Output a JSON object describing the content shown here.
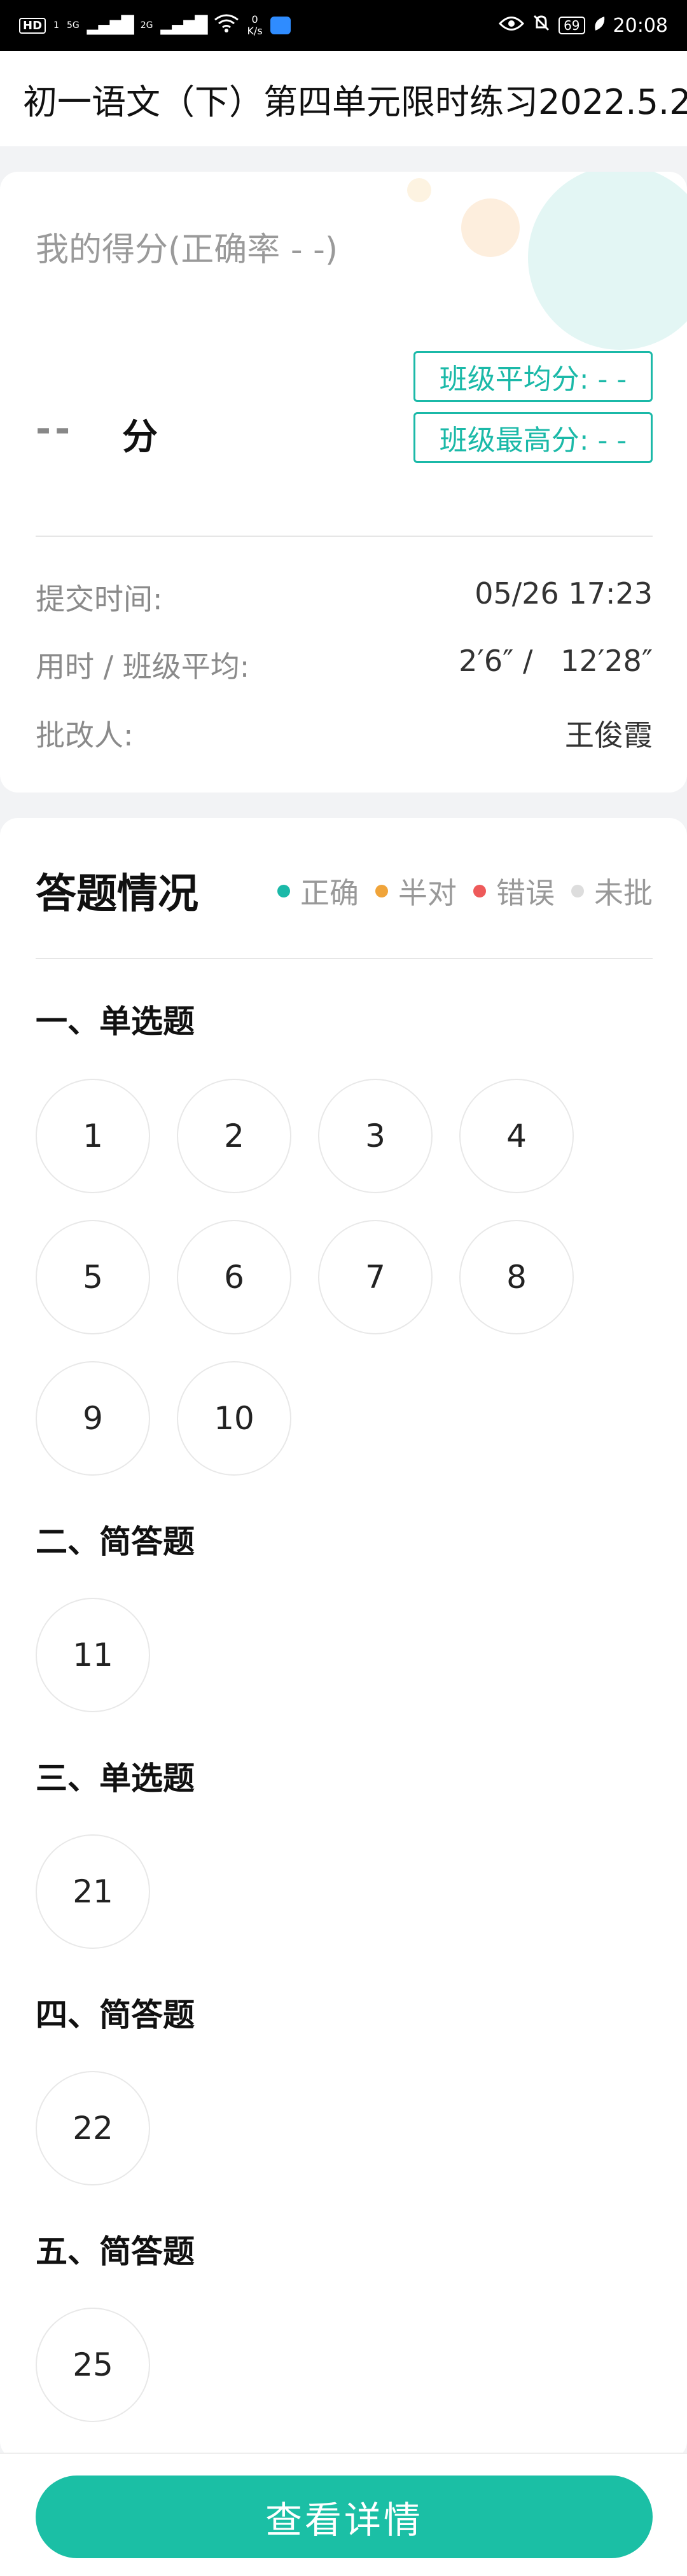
{
  "status_bar": {
    "hd": "HD",
    "sim": "1",
    "sig1_label": "5G",
    "sig2_label": "2G",
    "net_speed": "0",
    "net_unit": "K/s",
    "battery": "69",
    "time": "20:08"
  },
  "header": {
    "title": "初一语文（下）第四单元限时练习2022.5.2"
  },
  "score": {
    "label": "我的得分(正确率 - -)",
    "value": "--",
    "unit": "分",
    "class_avg": "班级平均分: - -",
    "class_max": "班级最高分: - -"
  },
  "info": {
    "submit_label": "提交时间:",
    "submit_value": "05/26 17:23",
    "time_label": "用时 / 班级平均:",
    "time_value": "2′6″ /   12′28″",
    "grader_label": "批改人:",
    "grader_value": "王俊霞"
  },
  "answers": {
    "title": "答题情况",
    "legend": [
      {
        "label": "正确",
        "color": "#1bb9a8"
      },
      {
        "label": "半对",
        "color": "#f0a43a"
      },
      {
        "label": "错误",
        "color": "#ee5a5a"
      },
      {
        "label": "未批",
        "color": "#dddddd"
      }
    ],
    "sections": [
      {
        "title": "一、单选题",
        "questions": [
          "1",
          "2",
          "3",
          "4",
          "5",
          "6",
          "7",
          "8",
          "9",
          "10"
        ]
      },
      {
        "title": "二、简答题",
        "questions": [
          "11"
        ]
      },
      {
        "title": "三、单选题",
        "questions": [
          "21"
        ]
      },
      {
        "title": "四、简答题",
        "questions": [
          "22"
        ]
      },
      {
        "title": "五、简答题",
        "questions": [
          "25"
        ]
      }
    ]
  },
  "footer": {
    "button_label": "查看详情"
  }
}
